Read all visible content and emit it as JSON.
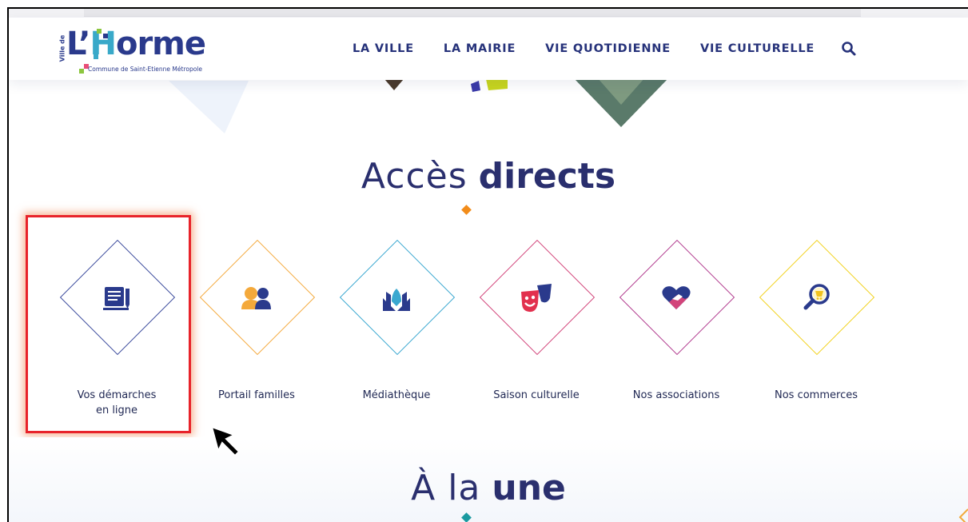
{
  "header": {
    "logo": {
      "prefix": "Ville de",
      "name_start": "L’",
      "name_h": "H",
      "name_end": "orme",
      "subtitle": "Commune de Saint-Etienne Métropole"
    },
    "nav": [
      {
        "label": "LA VILLE"
      },
      {
        "label": "LA MAIRIE"
      },
      {
        "label": "VIE QUOTIDIENNE"
      },
      {
        "label": "VIE CULTURELLE"
      }
    ],
    "search_icon": "search-icon"
  },
  "acces": {
    "title_light": "Accès",
    "title_bold": "directs",
    "accent_color": "#f28c1a",
    "tiles": [
      {
        "label_line1": "Vos démarches",
        "label_line2": "en ligne",
        "icon": "form-pen-icon",
        "color": "#3a4a9c"
      },
      {
        "label_line1": "Portail familles",
        "label_line2": "",
        "icon": "family-icon",
        "color": "#f4a93b"
      },
      {
        "label_line1": "Médiathèque",
        "label_line2": "",
        "icon": "book-icon",
        "color": "#3aa8d0"
      },
      {
        "label_line1": "Saison culturelle",
        "label_line2": "",
        "icon": "theater-masks-icon",
        "color": "#d2447a"
      },
      {
        "label_line1": "Nos associations",
        "label_line2": "",
        "icon": "heart-handshake-icon",
        "color": "#b23a8e"
      },
      {
        "label_line1": "Nos commerces",
        "label_line2": "",
        "icon": "shop-search-icon",
        "color": "#f2d21e"
      }
    ]
  },
  "une": {
    "title_light": "À la",
    "title_bold": "une",
    "accent_color": "#1a9aa0"
  }
}
